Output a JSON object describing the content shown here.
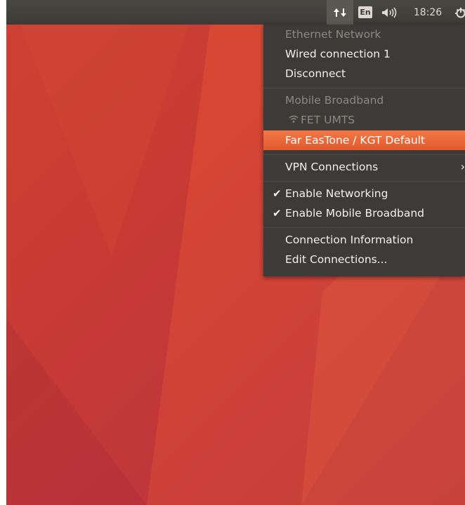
{
  "panel": {
    "keyboard_layout": "En",
    "clock": "18:26",
    "icons": {
      "network": "network-up-down-arrows-icon",
      "sound": "speaker-volume-icon",
      "session": "gear-power-icon"
    }
  },
  "menu": {
    "ethernet_header": "Ethernet Network",
    "wired_connection": "Wired connection 1",
    "disconnect": "Disconnect",
    "mobile_header": "Mobile Broadband",
    "fet_umts": "FET UMTS",
    "far_eastone": "Far EasTone / KGT Default",
    "vpn_connections": "VPN Connections",
    "vpn_arrow": "›",
    "enable_networking": "Enable Networking",
    "enable_mobile": "Enable Mobile Broadband",
    "check_mark": "✔",
    "connection_info": "Connection Information",
    "edit_connections": "Edit Connections..."
  },
  "colors": {
    "panel": "#3c3b37",
    "menu_bg": "#3c3b37",
    "highlight": "#e95420",
    "desktop": "#d0402f"
  }
}
